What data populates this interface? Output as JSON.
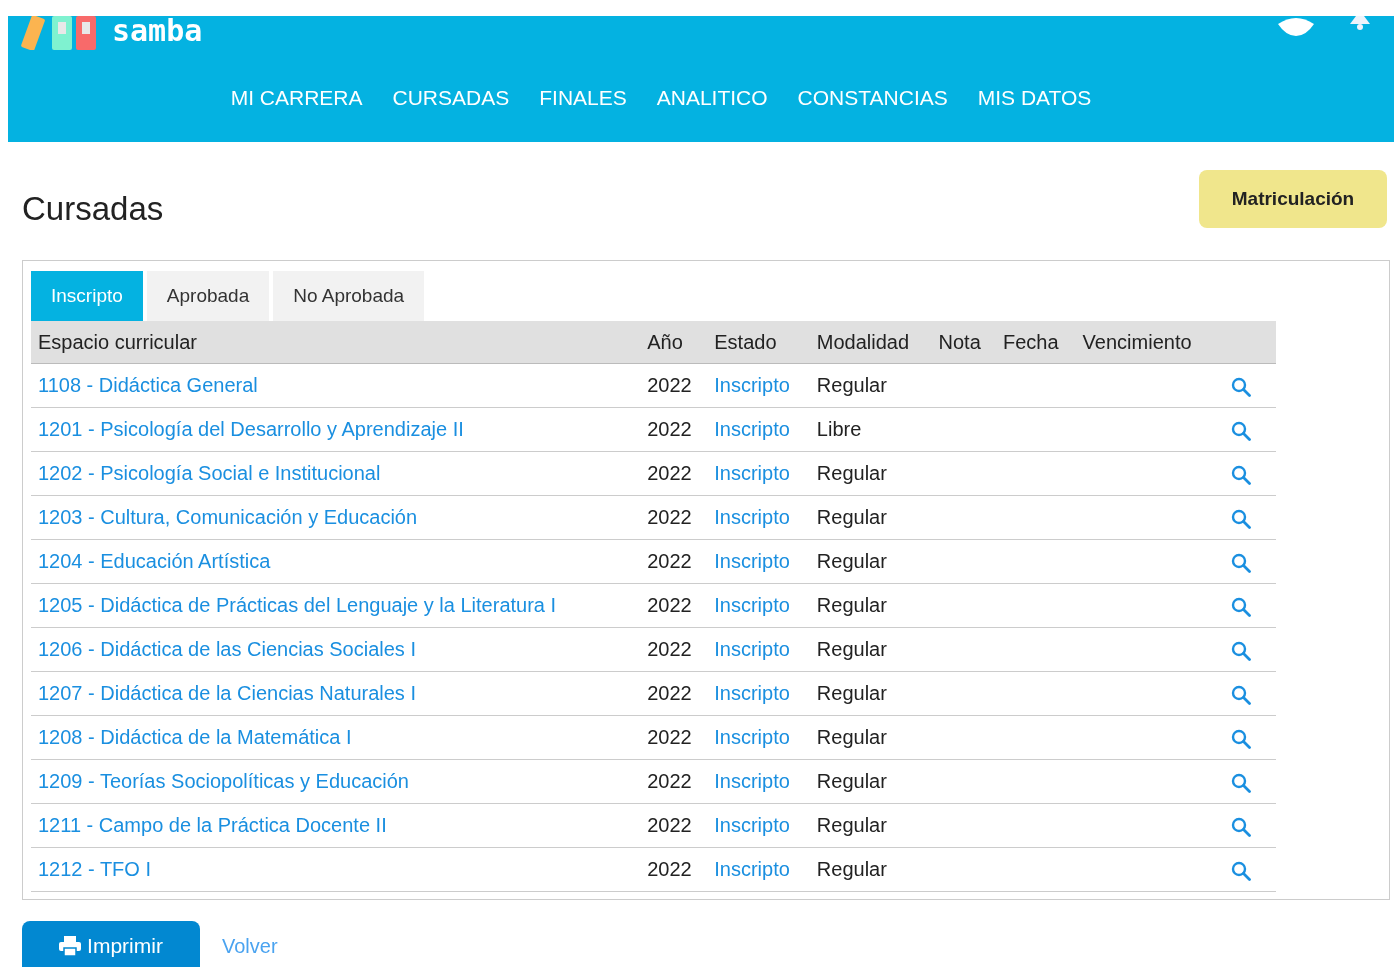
{
  "header": {
    "logo": "samba",
    "nav": [
      {
        "label": "MI CARRERA",
        "selected": false
      },
      {
        "label": "CURSADAS",
        "selected": false
      },
      {
        "label": "FINALES",
        "selected": false
      },
      {
        "label": "ANALITICO",
        "selected": false
      },
      {
        "label": "CONSTANCIAS",
        "selected": false
      },
      {
        "label": "MIS DATOS",
        "selected": false
      }
    ]
  },
  "page": {
    "title": "Cursadas",
    "action_button": "Matriculación"
  },
  "tabs": [
    {
      "label": "Inscripto",
      "selected": true
    },
    {
      "label": "Aprobada",
      "selected": false
    },
    {
      "label": "No Aprobada",
      "selected": false
    }
  ],
  "table": {
    "columns": [
      "Espacio curricular",
      "Año",
      "Estado",
      "Modalidad",
      "Nota",
      "Fecha",
      "Vencimiento"
    ],
    "rows": [
      {
        "subject": "1108 - Didáctica General",
        "year": "2022",
        "status": "Inscripto",
        "mode": "Regular"
      },
      {
        "subject": "1201 - Psicología del Desarrollo y Aprendizaje II",
        "year": "2022",
        "status": "Inscripto",
        "mode": "Libre"
      },
      {
        "subject": "1202 - Psicología Social e Institucional",
        "year": "2022",
        "status": "Inscripto",
        "mode": "Regular"
      },
      {
        "subject": "1203 - Cultura, Comunicación y Educación",
        "year": "2022",
        "status": "Inscripto",
        "mode": "Regular"
      },
      {
        "subject": "1204 - Educación Artística",
        "year": "2022",
        "status": "Inscripto",
        "mode": "Regular"
      },
      {
        "subject": "1205 - Didáctica de Prácticas del Lenguaje y la Literatura I",
        "year": "2022",
        "status": "Inscripto",
        "mode": "Regular"
      },
      {
        "subject": "1206 - Didáctica de las Ciencias Sociales I",
        "year": "2022",
        "status": "Inscripto",
        "mode": "Regular"
      },
      {
        "subject": "1207 - Didáctica de la Ciencias Naturales I",
        "year": "2022",
        "status": "Inscripto",
        "mode": "Regular"
      },
      {
        "subject": "1208 - Didáctica de la Matemática I",
        "year": "2022",
        "status": "Inscripto",
        "mode": "Regular"
      },
      {
        "subject": "1209 - Teorías Sociopolíticas y Educación",
        "year": "2022",
        "status": "Inscripto",
        "mode": "Regular"
      },
      {
        "subject": "1211 - Campo de la Práctica Docente II",
        "year": "2022",
        "status": "Inscripto",
        "mode": "Regular"
      },
      {
        "subject": "1212 - TFO I",
        "year": "2022",
        "status": "Inscripto",
        "mode": "Regular"
      }
    ]
  },
  "footer": {
    "print_button": "Imprimir",
    "back_link": "Volver"
  }
}
